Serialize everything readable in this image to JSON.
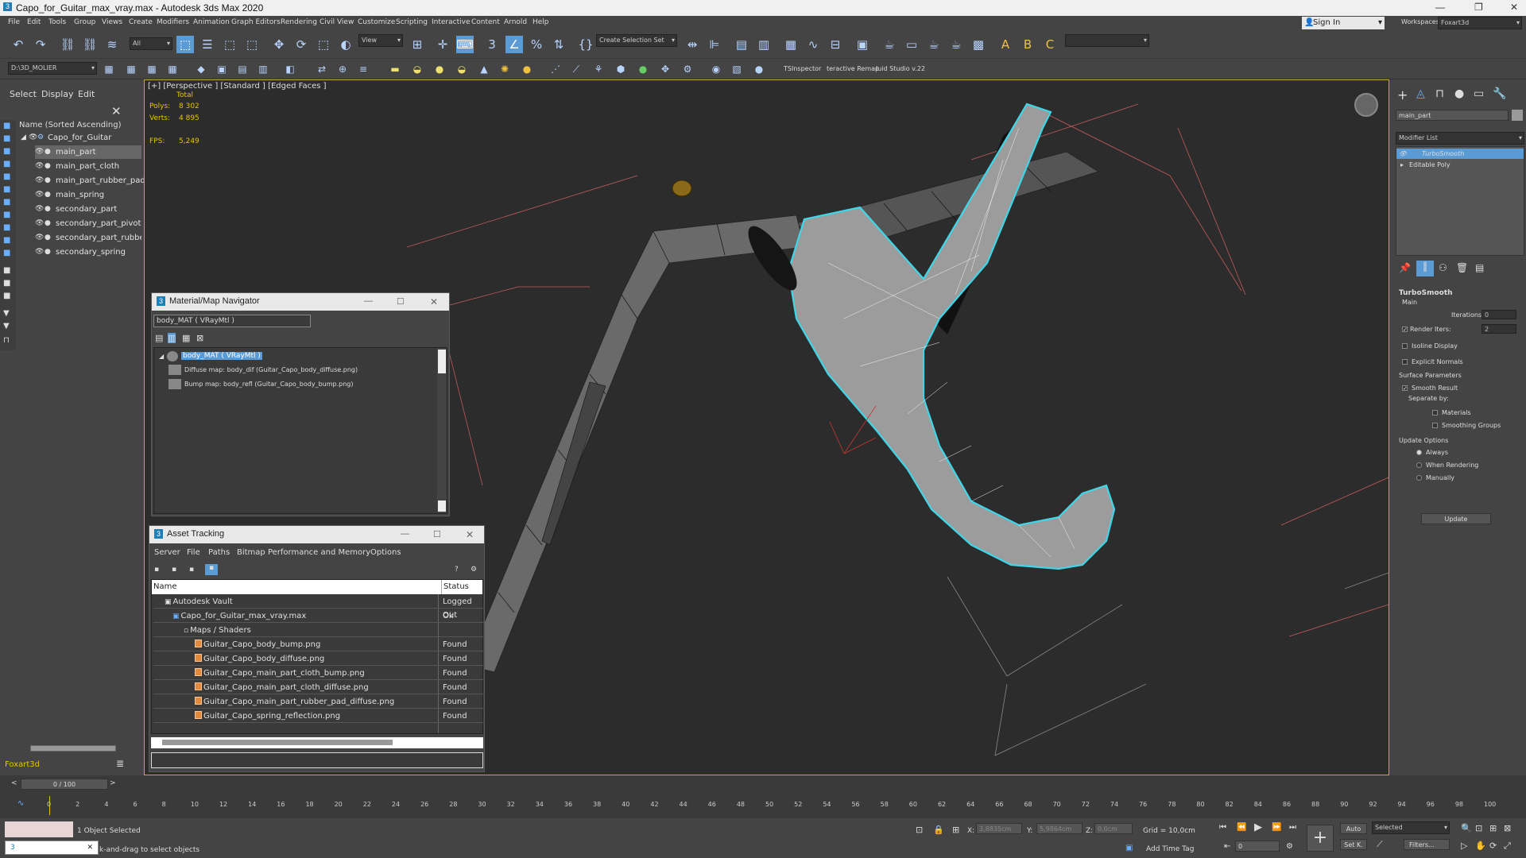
{
  "window": {
    "title": "Capo_for_Guitar_max_vray.max - Autodesk 3ds Max 2020"
  },
  "menu": [
    "File",
    "Edit",
    "Tools",
    "Group",
    "Views",
    "Create",
    "Modifiers",
    "Animation",
    "Graph Editors",
    "Rendering",
    "Civil View",
    "Customize",
    "Scripting",
    "Interactive",
    "Content",
    "Arnold",
    "Help"
  ],
  "topright": {
    "signin": "Sign In",
    "workspaces_label": "Workspaces:",
    "workspace": "Foxart3d"
  },
  "toolbar": {
    "filter": "All",
    "view": "View",
    "selection_set": "Create Selection Set",
    "project_path": "D:\\3D_MOLIER",
    "ts_inspector": "TSInspector",
    "interactive_remap": "teractive Remap",
    "fluid_studio": "luid Studio v.22"
  },
  "scene_explorer": {
    "tabs": [
      "Select",
      "Display",
      "Edit"
    ],
    "header": "Name (Sorted Ascending)",
    "root": "Capo_for_Guitar",
    "items": [
      "main_part",
      "main_part_cloth",
      "main_part_rubber_pad",
      "main_spring",
      "secondary_part",
      "secondary_part_pivot",
      "secondary_part_rubber_p",
      "secondary_spring"
    ],
    "layer": "Foxart3d"
  },
  "viewport": {
    "label": "[+] [Perspective ] [Standard ] [Edged Faces ]",
    "total_label": "Total",
    "polys_label": "Polys:",
    "polys": "8 302",
    "verts_label": "Verts:",
    "verts": "4 895",
    "fps_label": "FPS:",
    "fps": "5,249"
  },
  "command_panel": {
    "object_name": "main_part",
    "modifier_list": "Modifier List",
    "stack": [
      "TurboSmooth",
      "Editable Poly"
    ],
    "rollout": "TurboSmooth",
    "main": "Main",
    "iterations_label": "Iterations:",
    "iterations": "0",
    "render_iters_label": "Render Iters:",
    "render_iters": "2",
    "isoline": "Isoline Display",
    "explicit_normals": "Explicit Normals",
    "surface_params": "Surface Parameters",
    "smooth_result": "Smooth Result",
    "separate_by": "Separate by:",
    "materials": "Materials",
    "smoothing_groups": "Smoothing Groups",
    "update_options": "Update Options",
    "always": "Always",
    "when_rendering": "When Rendering",
    "manually": "Manually",
    "update_button": "Update"
  },
  "material_navigator": {
    "title": "Material/Map Navigator",
    "field": "body_MAT  ( VRayMtl )",
    "root": "body_MAT  ( VRayMtl )",
    "children": [
      "Diffuse map: body_dif (Guitar_Capo_body_diffuse.png)",
      "Bump map: body_refl (Guitar_Capo_body_bump.png)"
    ]
  },
  "asset_tracking": {
    "title": "Asset Tracking",
    "menu": [
      "Server",
      "File",
      "Paths",
      "Bitmap Performance and Memory",
      "Options"
    ],
    "columns": [
      "Name",
      "Status"
    ],
    "rows": [
      {
        "name": "Autodesk Vault",
        "status": "Logged Out"
      },
      {
        "name": "Capo_for_Guitar_max_vray.max",
        "status": "Ok"
      },
      {
        "name": "Maps / Shaders",
        "status": ""
      },
      {
        "name": "Guitar_Capo_body_bump.png",
        "status": "Found"
      },
      {
        "name": "Guitar_Capo_body_diffuse.png",
        "status": "Found"
      },
      {
        "name": "Guitar_Capo_main_part_cloth_bump.png",
        "status": "Found"
      },
      {
        "name": "Guitar_Capo_main_part_cloth_diffuse.png",
        "status": "Found"
      },
      {
        "name": "Guitar_Capo_main_part_rubber_pad_diffuse.png",
        "status": "Found"
      },
      {
        "name": "Guitar_Capo_spring_reflection.png",
        "status": "Found"
      }
    ]
  },
  "timeline": {
    "frame": "0 / 100",
    "ticks": [
      "0",
      "2",
      "4",
      "6",
      "8",
      "10",
      "12",
      "14",
      "16",
      "18",
      "20",
      "22",
      "24",
      "26",
      "28",
      "30",
      "32",
      "34",
      "36",
      "38",
      "40",
      "42",
      "44",
      "46",
      "48",
      "50",
      "52",
      "54",
      "56",
      "58",
      "60",
      "62",
      "64",
      "66",
      "68",
      "70",
      "72",
      "74",
      "76",
      "78",
      "80",
      "82",
      "84",
      "86",
      "88",
      "90",
      "92",
      "94",
      "96",
      "98",
      "100"
    ]
  },
  "status": {
    "selected": "1 Object Selected",
    "prompt": "k-and-drag to select objects",
    "x_label": "X:",
    "x": "3,8835cm",
    "y_label": "Y:",
    "y": "5,9864cm",
    "z_label": "Z:",
    "z": "0,0cm",
    "grid": "Grid = 10,0cm",
    "add_time_tag": "Add Time Tag",
    "auto": "Auto",
    "set_key": "Set K.",
    "selected_dd": "Selected",
    "filters": "Filters...",
    "frame_field": "0"
  },
  "colors": {
    "accent": "#5b9bd5",
    "viewport_border": "#c9a833",
    "selection_outline": "#3fd6e8",
    "stats": "#e6c400"
  }
}
